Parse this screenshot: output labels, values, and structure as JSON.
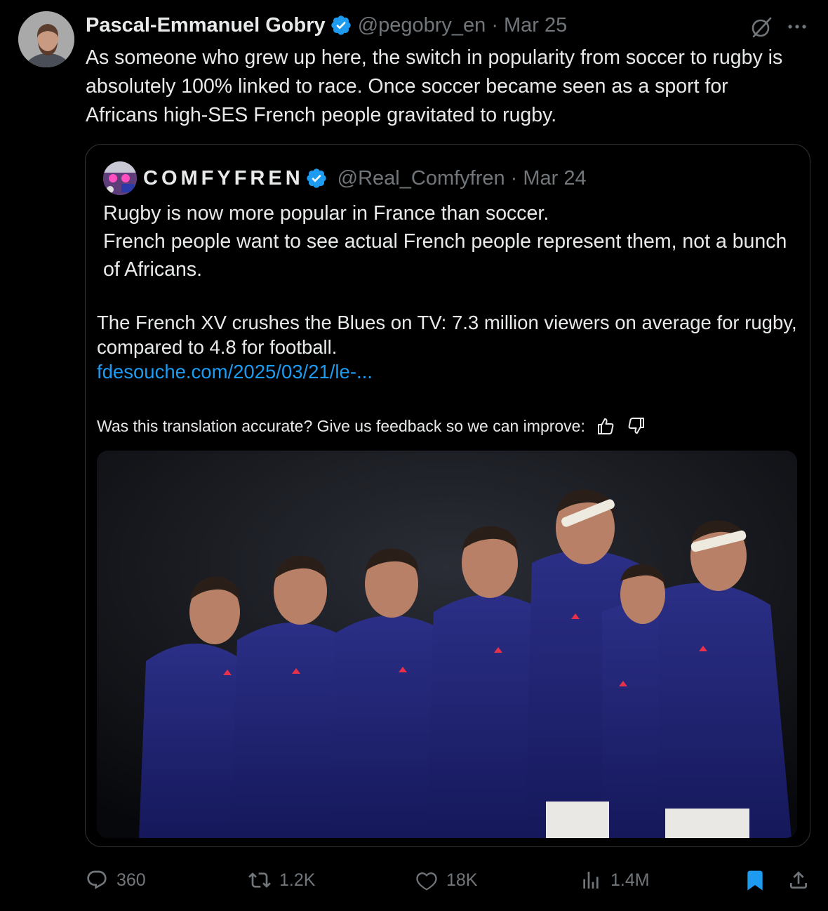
{
  "tweet": {
    "display_name": "Pascal-Emmanuel Gobry",
    "handle": "@pegobry_en",
    "separator": "·",
    "date": "Mar 25",
    "text": "As someone who grew up here, the switch in popularity from soccer to rugby is absolutely 100% linked to race. Once soccer became seen as a sport for Africans high-SES French people gravitated to rugby.",
    "icons": {
      "verified": "verified-badge-icon",
      "grok": "grok-icon",
      "more": "more-icon"
    }
  },
  "quote": {
    "display_name": "COMFYFREN",
    "handle": "@Real_Comfyfren",
    "separator": "·",
    "date": "Mar 24",
    "text_line1": "Rugby is now more popular in France than soccer.",
    "text_line2": "French people want to see actual French people represent them, not a bunch of Africans.",
    "translation_text": "The French XV crushes the Blues on TV: 7.3 million viewers on average for rugby, compared to 4.8 for football.",
    "translation_link": "fdesouche.com/2025/03/21/le-...",
    "feedback_prompt": "Was this translation accurate? Give us feedback so we can improve:",
    "media_description_icon": "photo-rugby-team"
  },
  "actions": {
    "replies": "360",
    "reposts": "1.2K",
    "likes": "18K",
    "views": "1.4M"
  },
  "colors": {
    "background": "#000000",
    "text": "#e7e9ea",
    "secondary": "#71767b",
    "accent": "#1d9bf0",
    "border": "#2f3336"
  }
}
